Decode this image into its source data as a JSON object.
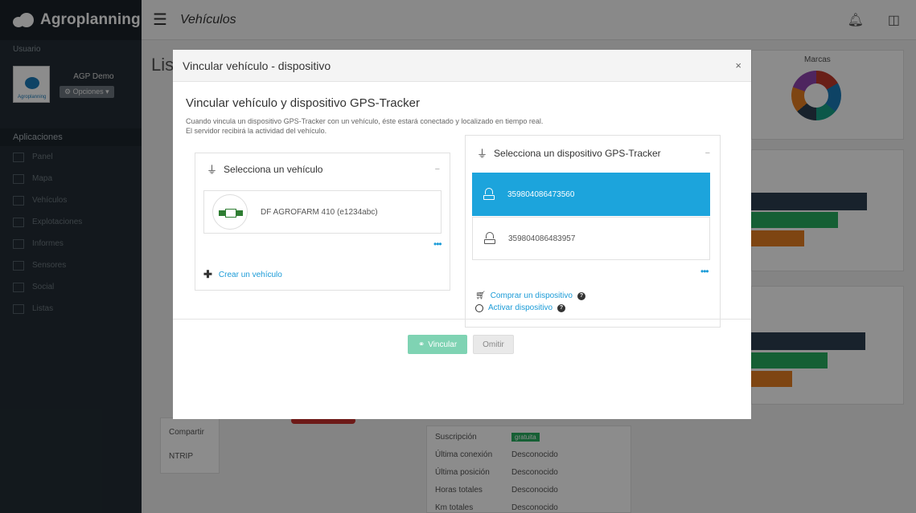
{
  "app": {
    "brand": "Agroplanning"
  },
  "sidebar": {
    "user_label": "Usuario",
    "user_name": "AGP Demo",
    "options_label": "⚙ Opciones ▾",
    "avatar_text": "Agroplanning",
    "apps_label": "Aplicaciones",
    "items": [
      {
        "label": "Panel"
      },
      {
        "label": "Mapa"
      },
      {
        "label": "Vehículos"
      },
      {
        "label": "Explotaciones"
      },
      {
        "label": "Informes"
      },
      {
        "label": "Sensores"
      },
      {
        "label": "Social"
      },
      {
        "label": "Listas"
      }
    ]
  },
  "topbar": {
    "title": "Vehículos"
  },
  "background": {
    "list_title": "Lis",
    "marcas_label": "Marcas",
    "compartir": "Compartir",
    "ntrip": "NTRIP",
    "details": [
      {
        "key": "Suscripción",
        "value": "gratuita"
      },
      {
        "key": "Última conexión",
        "value": "Desconocido"
      },
      {
        "key": "Última posición",
        "value": "Desconocido"
      },
      {
        "key": "Horas totales",
        "value": "Desconocido"
      },
      {
        "key": "Km totales",
        "value": "Desconocido"
      }
    ]
  },
  "modal": {
    "title": "Vincular vehículo - dispositivo",
    "close": "×",
    "heading": "Vincular vehículo y dispositivo GPS-Tracker",
    "desc_line1": "Cuando vincula un dispositivo GPS-Tracker con un vehículo, éste estará conectado y localizado en tiempo real.",
    "desc_line2": "El servidor recibirá la actividad del vehículo.",
    "vehicle_panel": {
      "title": "Selecciona un vehículo",
      "toggle": "−",
      "vehicle": "DF AGROFARM 410 (e1234abc)",
      "more": "•••",
      "create": "Crear un vehículo"
    },
    "device_panel": {
      "title": "Selecciona un dispositivo GPS-Tracker",
      "toggle": "−",
      "devices": [
        "359804086473560",
        "359804086483957"
      ],
      "more": "•••",
      "buy": "Comprar un dispositivo",
      "activate": "Activar dispositivo"
    },
    "link_button": "Vincular",
    "skip_button": "Omitir"
  }
}
